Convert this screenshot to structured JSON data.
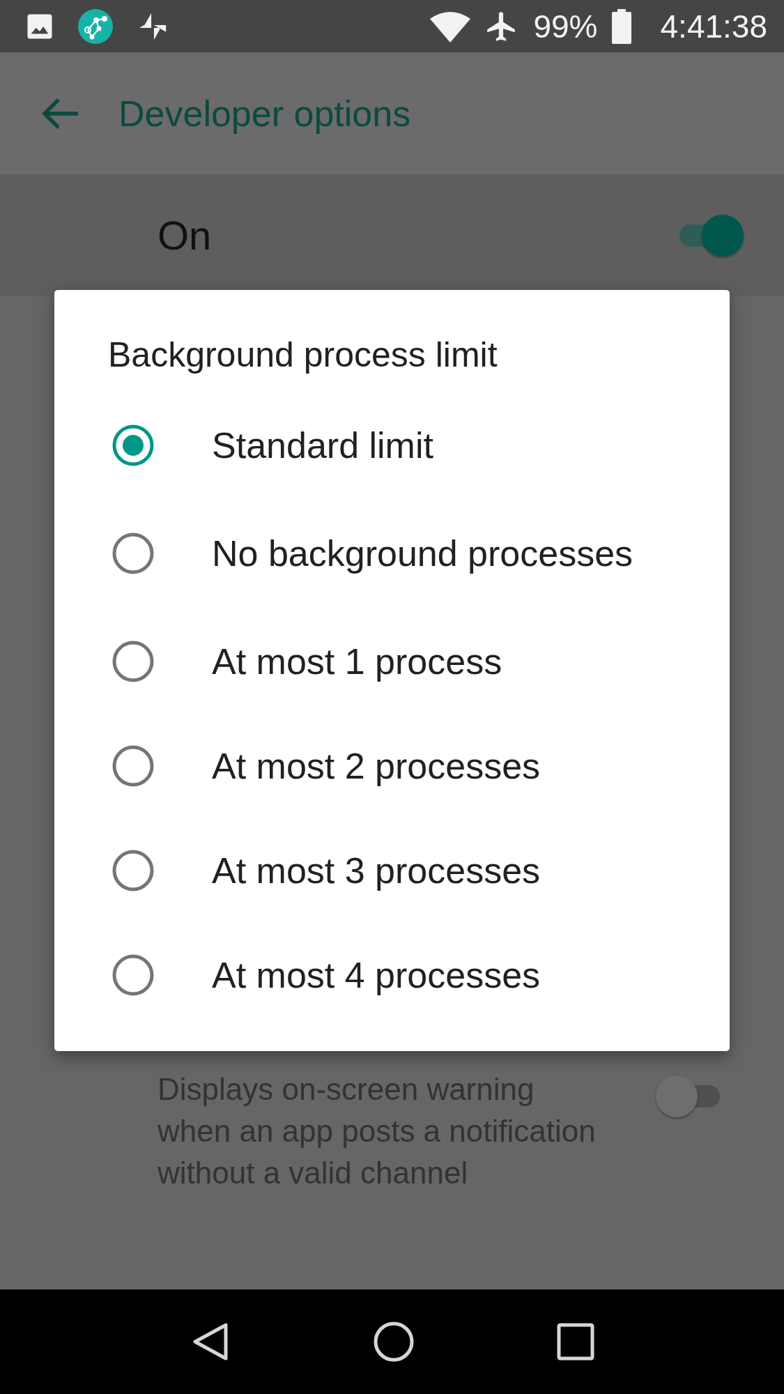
{
  "status_bar": {
    "battery": "99%",
    "time": "4:41:38"
  },
  "app_bar": {
    "title": "Developer options"
  },
  "master_switch": {
    "label": "On",
    "on": true
  },
  "settings": [
    {
      "description": "Displays on-screen warning when an app posts a notification without a valid channel",
      "on": false
    }
  ],
  "dialog": {
    "title": "Background process limit",
    "options": [
      {
        "label": "Standard limit",
        "selected": true
      },
      {
        "label": "No background processes",
        "selected": false
      },
      {
        "label": "At most 1 process",
        "selected": false
      },
      {
        "label": "At most 2 processes",
        "selected": false
      },
      {
        "label": "At most 3 processes",
        "selected": false
      },
      {
        "label": "At most 4 processes",
        "selected": false
      }
    ]
  }
}
